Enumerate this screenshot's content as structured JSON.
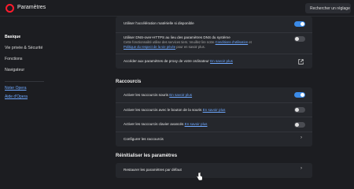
{
  "header": {
    "app_title": "Paramètres",
    "search_placeholder": "Rechercher un réglage"
  },
  "sidebar": {
    "items": [
      "Basique",
      "Vie privée & Sécurité",
      "Fonctions",
      "Navigateur"
    ],
    "links": [
      "Noter Opera",
      "Aide d'Opera"
    ]
  },
  "system_card": {
    "hw_accel": {
      "label": "Utiliser l'accélération matérielle si disponible",
      "enabled": true
    },
    "dns": {
      "label": "Utiliser DNS-over-HTTPS au lieu des paramètres DNS du système",
      "desc_line1": "Cette fonctionnalité utilise des services tiers. Veuillez lire notre",
      "desc_link1": "Conditions d'utilisation",
      "desc_and": "et",
      "desc_link2": "Politique du respect de la vie privée",
      "desc_tail": "pour en savoir plus.",
      "enabled": false
    },
    "proxy": {
      "label": "Accéder aux paramètres de proxy de votre ordinateur",
      "link": "En savoir plus"
    }
  },
  "shortcuts": {
    "title": "Raccourcis",
    "rows": [
      {
        "label": "Activer les raccourcis souris",
        "link": "En savoir plus",
        "enabled": true
      },
      {
        "label": "Activer les raccourcis avec le bouton de la souris",
        "link": "En savoir plus",
        "enabled": false
      },
      {
        "label": "Activer les raccourcis clavier avancés",
        "link": "En savoir plus",
        "enabled": false
      }
    ],
    "configure": "Configurer les raccourcis"
  },
  "reset": {
    "title": "Réinitialiser les paramètres",
    "restore": "Restaurer les paramètres par défaut"
  },
  "colors": {
    "accent": "#3b8be8",
    "brand": "#ff1b2d",
    "link": "#6ea8ff"
  }
}
